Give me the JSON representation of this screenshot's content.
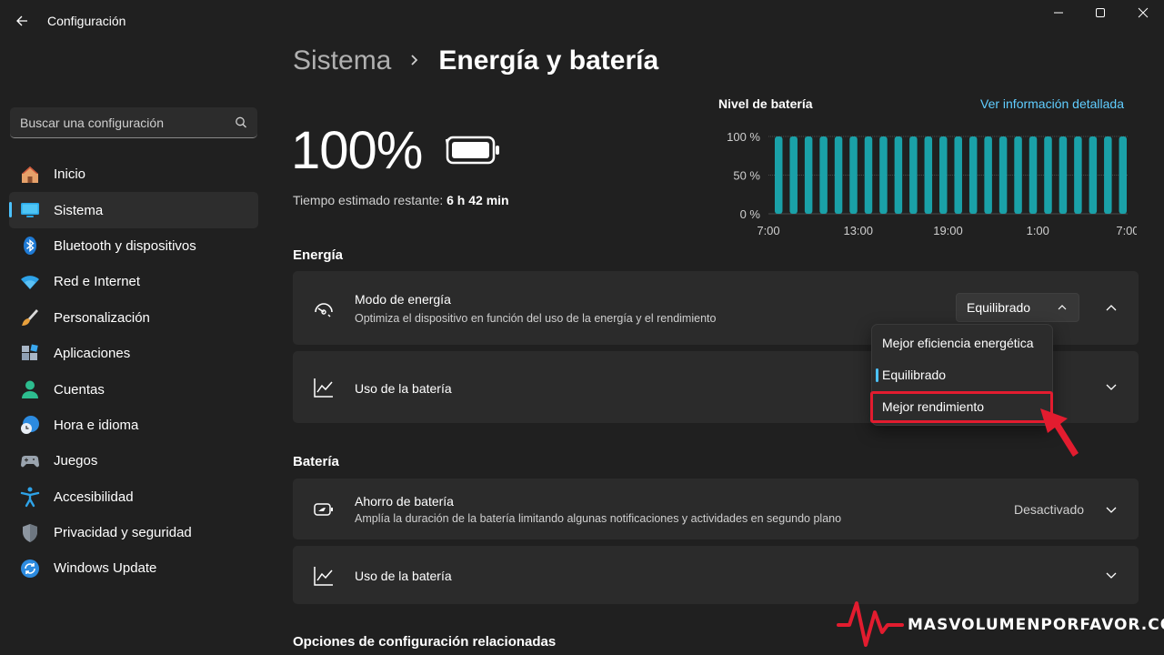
{
  "window": {
    "title": "Configuración"
  },
  "sidebar": {
    "search_placeholder": "Buscar una configuración",
    "items": [
      {
        "label": "Inicio",
        "icon": "home-icon"
      },
      {
        "label": "Sistema",
        "icon": "monitor-icon",
        "active": true
      },
      {
        "label": "Bluetooth y dispositivos",
        "icon": "bluetooth-icon"
      },
      {
        "label": "Red e Internet",
        "icon": "wifi-icon"
      },
      {
        "label": "Personalización",
        "icon": "brush-icon"
      },
      {
        "label": "Aplicaciones",
        "icon": "apps-icon"
      },
      {
        "label": "Cuentas",
        "icon": "account-icon"
      },
      {
        "label": "Hora e idioma",
        "icon": "clock-globe-icon"
      },
      {
        "label": "Juegos",
        "icon": "gamepad-icon"
      },
      {
        "label": "Accesibilidad",
        "icon": "accessibility-icon"
      },
      {
        "label": "Privacidad y seguridad",
        "icon": "shield-icon"
      },
      {
        "label": "Windows Update",
        "icon": "update-icon"
      }
    ]
  },
  "header": {
    "parent": "Sistema",
    "current": "Energía y batería"
  },
  "battery": {
    "percent": "100%",
    "time_label": "Tiempo estimado restante:",
    "time_value": "6 h 42 min"
  },
  "chart_data": {
    "type": "bar",
    "title": "Nivel de batería",
    "link": "Ver información detallada",
    "y_ticks": [
      "100 %",
      "50 %",
      "0 %"
    ],
    "x_ticks": [
      "7:00",
      "13:00",
      "19:00",
      "1:00",
      "7:00"
    ],
    "ylim": [
      0,
      100
    ],
    "values": [
      100,
      100,
      100,
      100,
      100,
      100,
      100,
      100,
      100,
      100,
      100,
      100,
      100,
      100,
      100,
      100,
      100,
      100,
      100,
      100,
      100,
      100,
      100,
      100
    ],
    "color": "#1aa1a8",
    "grid": true
  },
  "energy": {
    "section_title": "Energía",
    "mode_card": {
      "title": "Modo de energía",
      "subtitle": "Optimiza el dispositivo en función del uso de la energía y el rendimiento",
      "selected": "Equilibrado"
    },
    "usage_card": {
      "title": "Uso de la batería"
    },
    "dropdown_options": [
      "Mejor eficiencia energética",
      "Equilibrado",
      "Mejor rendimiento"
    ]
  },
  "battery_section": {
    "section_title": "Batería",
    "saver_card": {
      "title": "Ahorro de batería",
      "subtitle": "Amplía la duración de la batería limitando algunas notificaciones y actividades en segundo plano",
      "value": "Desactivado"
    },
    "usage_card": {
      "title": "Uso de la batería"
    }
  },
  "related": {
    "section_title": "Opciones de configuración relacionadas"
  },
  "watermark": {
    "text": "MASVOLUMENPORFAVOR.COM"
  },
  "colors": {
    "accent": "#4cc2ff",
    "link": "#60cdff",
    "highlight": "#e21c2f"
  }
}
